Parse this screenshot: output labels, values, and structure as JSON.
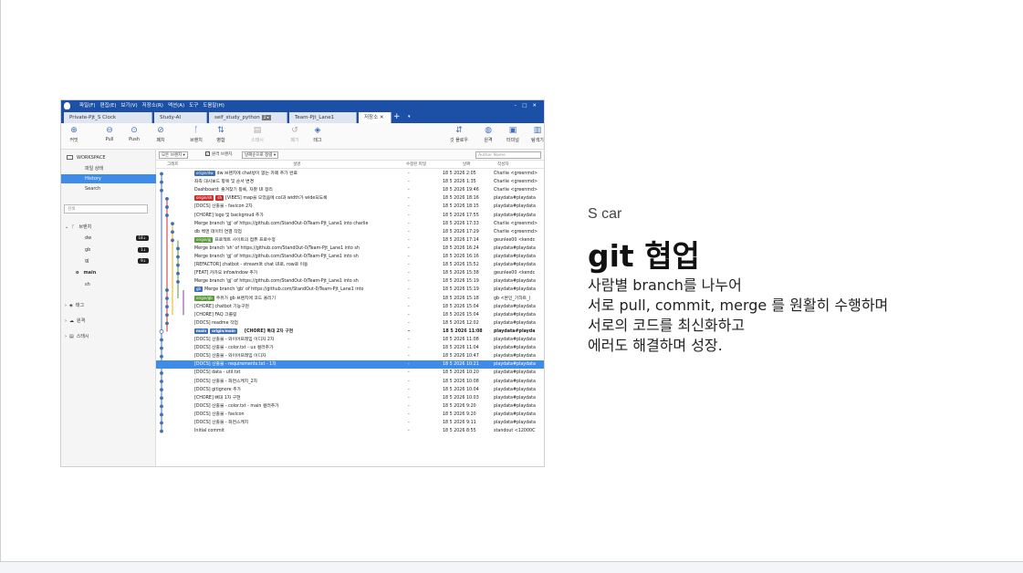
{
  "slide": {
    "subtitle": "S car",
    "title": "git 협업",
    "lines": [
      "사람별 branch를 나누어",
      "서로 pull, commit, merge 를 원활히 수행하며",
      "서로의 코드를 최신화하고",
      "에러도 해결하며 성장."
    ]
  },
  "sourcetree": {
    "menus": [
      "파일(F)",
      "편집(E)",
      "보기(V)",
      "저장소(R)",
      "액션(A)",
      "도구",
      "도움말(H)"
    ],
    "window_buttons": [
      "–",
      "□",
      "✕"
    ],
    "tabs": [
      {
        "label": "Private-Pjt_S Clock"
      },
      {
        "label": "Study-AI"
      },
      {
        "label": "self_study_python",
        "tag": "2 ▾"
      },
      {
        "label": "Team-Pjt_Lane1"
      },
      {
        "label": "저장소 ✕"
      }
    ],
    "tab_plus": "+",
    "tab_dropdown": "▾",
    "toolbar_left": [
      {
        "label": "커밋",
        "icon": "commit-icon",
        "glyph": "⊕"
      },
      {
        "label": "Pull",
        "icon": "pull-icon",
        "glyph": "⊖"
      },
      {
        "label": "Push",
        "icon": "push-icon",
        "glyph": "⊙"
      },
      {
        "label": "패치",
        "icon": "fetch-icon",
        "glyph": "⊘"
      },
      {
        "label": "브랜치",
        "icon": "branch-icon",
        "glyph": "ᚴ"
      },
      {
        "label": "병합",
        "icon": "merge-icon",
        "glyph": "⇅"
      },
      {
        "label": "스태시",
        "icon": "stash-icon",
        "glyph": "▤",
        "disabled": true
      },
      {
        "label": "폐기",
        "icon": "discard-icon",
        "glyph": "↺",
        "disabled": true
      },
      {
        "label": "태그",
        "icon": "tag-icon",
        "glyph": "◈"
      }
    ],
    "toolbar_right": [
      {
        "label": "깃 플로우",
        "icon": "git-flow-icon",
        "glyph": "⇵"
      },
      {
        "label": "원격",
        "icon": "remote-icon",
        "glyph": "◍"
      },
      {
        "label": "터미널",
        "icon": "terminal-icon",
        "glyph": "▣"
      },
      {
        "label": "탐색기",
        "icon": "explorer-icon",
        "glyph": "▥"
      }
    ],
    "sidebar": {
      "workspace": "WORKSPACE",
      "items": [
        "파일 상태",
        "History",
        "Search"
      ],
      "search_placeholder": "검색",
      "branches_label": "브랜치",
      "branches": [
        {
          "name": "dw",
          "badge": "18↓"
        },
        {
          "name": "gb",
          "badge": "1↓"
        },
        {
          "name": "gj",
          "badge": "9↓"
        },
        {
          "name": "main",
          "badge": ""
        },
        {
          "name": "sh",
          "badge": ""
        }
      ],
      "groups": [
        "태그",
        "원격",
        "스태시"
      ]
    },
    "filter": {
      "all_branches": "모든 브랜치 ▾",
      "show_remote": "원격 브랜치",
      "date_order": "날짜순으로 정렬 ▾",
      "author_placeholder": "Author Name"
    },
    "columns": {
      "graph": "그래프",
      "desc": "설명",
      "files": "수정된 파일",
      "date": "날짜",
      "author": "작성자"
    },
    "commits": [
      {
        "tags": [
          {
            "t": "origin/dw",
            "c": "blue"
          }
        ],
        "desc": "dw 브랜치에 chat방이 없는 카페 추가 완료",
        "files": "-",
        "date": "18 5 2026 2:05",
        "author": "Charlie <greenmd>"
      },
      {
        "tags": [],
        "desc": "좌측 대시보드 항목 및 순서 변경",
        "files": "-",
        "date": "18 5 2026 1:35",
        "author": "Charlie <greenmd>"
      },
      {
        "tags": [],
        "desc": "Dashboard: 즐겨찾기 등록, 자잘 UI 정리",
        "files": "-",
        "date": "18 5 2026 19:46",
        "author": "Charlie <greenmd>"
      },
      {
        "tags": [
          {
            "t": "origin/sh",
            "c": "red"
          },
          {
            "t": "sh",
            "c": "red"
          }
        ],
        "desc": "[VIBES] map을 모았음에 col과 width가 wide되도록",
        "files": "-",
        "date": "18 5 2026 18:16",
        "author": "playdata#playdata"
      },
      {
        "tags": [],
        "desc": "[DOCS] 산출물 - favicon 2차",
        "files": "-",
        "date": "18 5 2026 18:15",
        "author": "playdata#playdata"
      },
      {
        "tags": [],
        "desc": "[CHORE] logo 및 backgroud 추가",
        "files": "-",
        "date": "18 5 2026 17:55",
        "author": "playdata#playdata"
      },
      {
        "tags": [],
        "desc": "Merge branch 'gj' of https://github.com/StandOut-0/Team-Pjt_Lane1 into charlie",
        "files": "-",
        "date": "18 5 2026 17:33",
        "author": "Charlie <greenmd>"
      },
      {
        "tags": [],
        "desc": "db 백엔 데이터 연결 작업",
        "files": "-",
        "date": "18 5 2026 17:29",
        "author": "Charlie <greenmd>"
      },
      {
        "tags": [
          {
            "t": "origin/gj",
            "c": "green"
          }
        ],
        "desc": "프로젝트 사이트의 컴퓨 프로수정",
        "files": "-",
        "date": "18 5 2026 17:14",
        "author": "geunlee00 <kendc"
      },
      {
        "tags": [],
        "desc": "Merge branch 'sh' of https://github.com/StandOut-0/Team-Pjt_Lane1 into sh",
        "files": "-",
        "date": "18 5 2026 16:24",
        "author": "playdata#playdata"
      },
      {
        "tags": [],
        "desc": "Merge branch 'gj' of https://github.com/StandOut-0/Team-Pjt_Lane1 into sh",
        "files": "-",
        "date": "18 5 2026 16:16",
        "author": "playdata#playdata"
      },
      {
        "tags": [],
        "desc": "[REFACTOR] chatbot - streamlit chat UI로, row로 이동",
        "files": "-",
        "date": "18 5 2026 15:52",
        "author": "playdata#playdata"
      },
      {
        "tags": [],
        "desc": "[FEAT] 카카오 infowindow 추가",
        "files": "-",
        "date": "18 5 2026 15:38",
        "author": "geunlee00 <kendc"
      },
      {
        "tags": [],
        "desc": "Merge branch 'gj' of https://github.com/StandOut-0/Team-Pjt_Lane1 into sh",
        "files": "-",
        "date": "18 5 2026 15:19",
        "author": "playdata#playdata"
      },
      {
        "tags": [
          {
            "t": "gb",
            "c": "blue"
          }
        ],
        "desc": "Merge branch 'gb' of https://github.com/StandOut-0/Team-Pjt_Lane1 into",
        "files": "-",
        "date": "18 5 2026 15:19",
        "author": "playdata#playdata"
      },
      {
        "tags": [
          {
            "t": "origin/gb",
            "c": "green"
          }
        ],
        "desc": "주유가 gb 브랜치에 코드 올리기",
        "files": "-",
        "date": "18 5 2026 15:18",
        "author": "gb <본인_기하트_("
      },
      {
        "tags": [],
        "desc": "[CHORE] chatbot 기능구현",
        "files": "-",
        "date": "18 5 2026 15:04",
        "author": "playdata#playdata"
      },
      {
        "tags": [],
        "desc": "[CHORE] FAQ 크롤링",
        "files": "-",
        "date": "18 5 2026 15:04",
        "author": "playdata#playdata"
      },
      {
        "tags": [],
        "desc": "[DOCS] readme 작업",
        "files": "-",
        "date": "18 5 2026 12:02",
        "author": "playdata#playdata"
      },
      {
        "tags": [
          {
            "t": "main",
            "c": "blue"
          },
          {
            "t": "origin/main",
            "c": "blue"
          },
          {
            "t": " ",
            "c": "blue"
          }
        ],
        "desc": "[CHORE] 톡대 2차 구현",
        "files": "-",
        "date": "18 5 2026 11:08",
        "author": "playdata#playda",
        "bold": true
      },
      {
        "tags": [],
        "desc": "[DOCS] 산출물 - 와이어프레임 이디자 2차",
        "files": "-",
        "date": "18 5 2026 11:08",
        "author": "playdata#playdata"
      },
      {
        "tags": [],
        "desc": "[DOCS] 산출물 - color.txt - ux 컬러추가",
        "files": "-",
        "date": "18 5 2026 11:04",
        "author": "playdata#playdata"
      },
      {
        "tags": [],
        "desc": "[DOCS] 산출물 - 와이어프레임 이디자",
        "files": "-",
        "date": "18 5 2026 10:47",
        "author": "playdata#playdata"
      },
      {
        "tags": [],
        "desc": "[DOCS] 산출물 - requirements.txt - 1차",
        "files": "-",
        "date": "18 5 2026 10:21",
        "author": "playdata#playdata",
        "sel": true
      },
      {
        "tags": [],
        "desc": "[DOCS] data - util.txt",
        "files": "-",
        "date": "18 5 2026 10:20",
        "author": "playdata#playdata"
      },
      {
        "tags": [],
        "desc": "[DOCS] 산출물 - 화면스케치_2차",
        "files": "-",
        "date": "18 5 2026 10:08",
        "author": "playdata#playdata"
      },
      {
        "tags": [],
        "desc": "[DOCS] gitignore 추가",
        "files": "-",
        "date": "18 5 2026 10:04",
        "author": "playdata#playdata"
      },
      {
        "tags": [],
        "desc": "[CHORE] 뼈대 1차 구현",
        "files": "-",
        "date": "18 5 2026 10:03",
        "author": "playdata#playdata"
      },
      {
        "tags": [],
        "desc": "[DOCS] 산출물 - color.txt - main 컬러추가",
        "files": "-",
        "date": "18 5 2026 9:20",
        "author": "playdata#playdata"
      },
      {
        "tags": [],
        "desc": "[DOCS] 산출물 - favicon",
        "files": "-",
        "date": "18 5 2026 9:20",
        "author": "playdata#playdata"
      },
      {
        "tags": [],
        "desc": "[DOCS] 산출물 - 화면스케치",
        "files": "-",
        "date": "18 5 2026 9:11",
        "author": "playdata#playdata"
      },
      {
        "tags": [],
        "desc": "Initial commit",
        "files": "-",
        "date": "18 5 2026 8:55",
        "author": "standout <12000C"
      }
    ],
    "colors": {
      "titlebar": "#1c4fa6",
      "selection": "#3f8ce8",
      "tag_blue": "#3d6fb6",
      "tag_red": "#c9302c",
      "tag_green": "#5a9a3a"
    }
  }
}
